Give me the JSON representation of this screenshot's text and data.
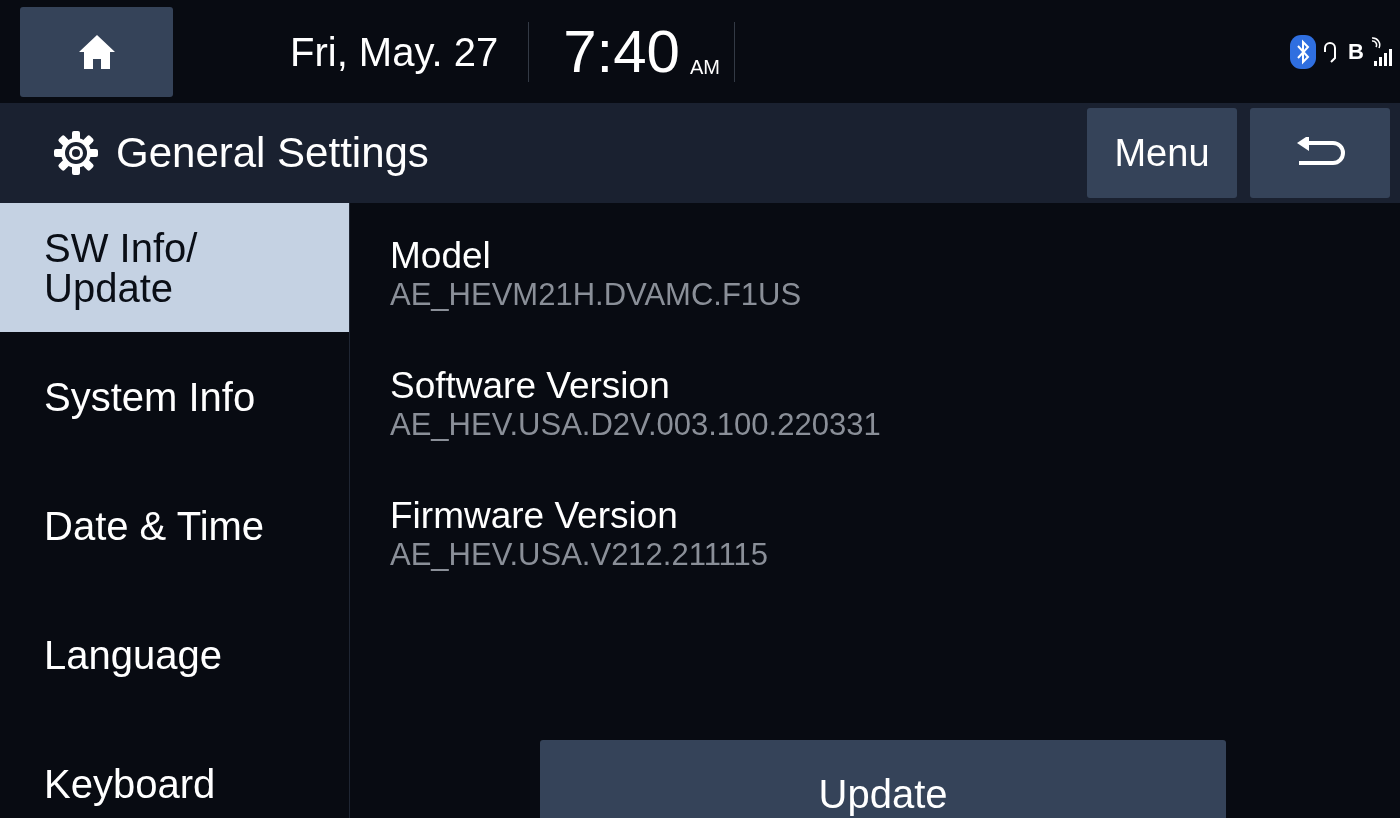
{
  "status_bar": {
    "date": "Fri, May. 27",
    "time": "7:40",
    "meridiem": "AM",
    "bluetooth_audio_label": "B"
  },
  "header": {
    "title": "General Settings",
    "menu_button": "Menu"
  },
  "sidebar": {
    "items": [
      {
        "label": "SW Info/\nUpdate",
        "selected": true
      },
      {
        "label": "System Info",
        "selected": false
      },
      {
        "label": "Date & Time",
        "selected": false
      },
      {
        "label": "Language",
        "selected": false
      },
      {
        "label": "Keyboard",
        "selected": false
      }
    ]
  },
  "info": [
    {
      "label": "Model",
      "value": "AE_HEVM21H.DVAMC.F1US"
    },
    {
      "label": "Software Version",
      "value": "AE_HEV.USA.D2V.003.100.220331"
    },
    {
      "label": "Firmware Version",
      "value": "AE_HEV.USA.V212.211115"
    }
  ],
  "update_button": "Update"
}
